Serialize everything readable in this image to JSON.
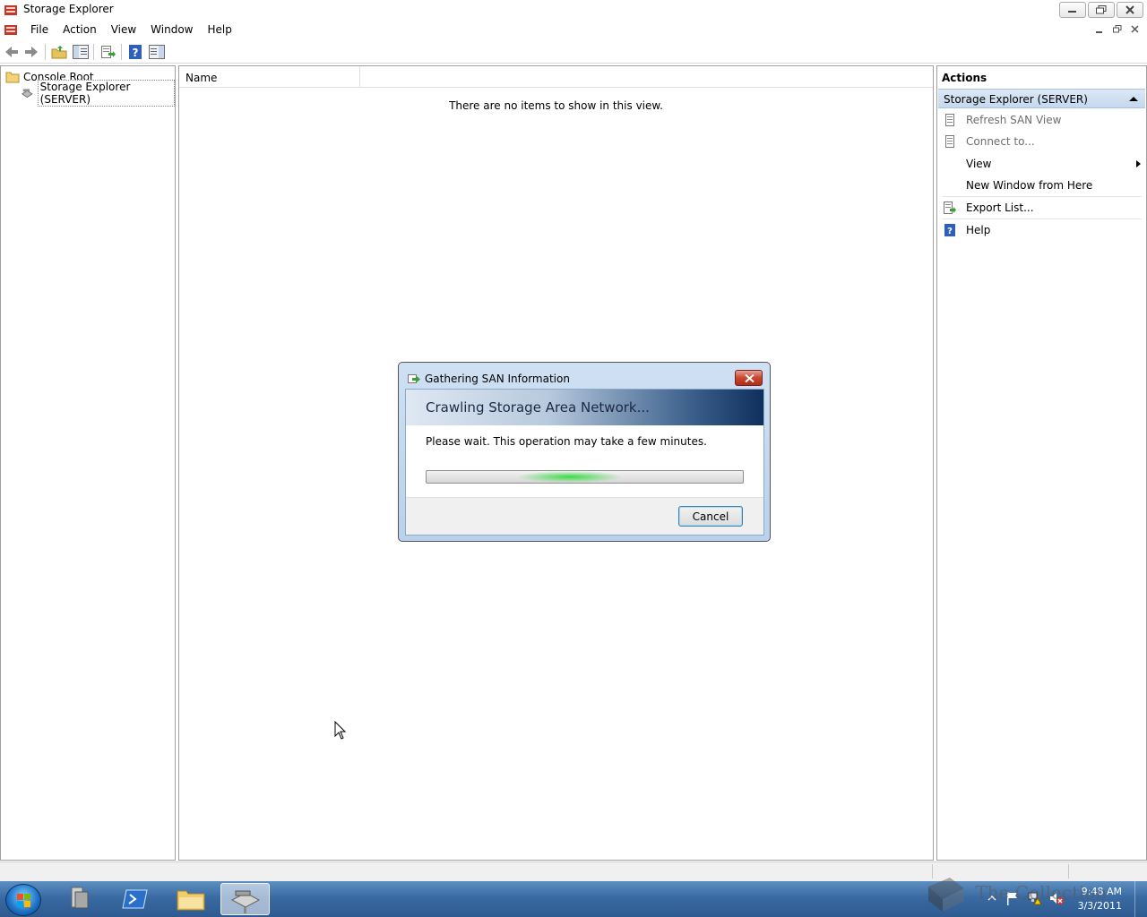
{
  "window": {
    "title": "Storage Explorer"
  },
  "menu": {
    "items": [
      "File",
      "Action",
      "View",
      "Window",
      "Help"
    ]
  },
  "tree": {
    "root": "Console Root",
    "child": "Storage Explorer (SERVER)"
  },
  "list": {
    "column_name": "Name",
    "empty_message": "There are no items to show in this view."
  },
  "actions": {
    "title": "Actions",
    "section": "Storage Explorer (SERVER)",
    "items": [
      {
        "label": "Refresh SAN View",
        "icon": "refresh-san-icon",
        "enabled": false
      },
      {
        "label": "Connect to...",
        "icon": "connect-icon",
        "enabled": false
      },
      {
        "label": "View",
        "icon": "",
        "enabled": true,
        "submenu": true
      },
      {
        "label": "New Window from Here",
        "icon": "",
        "enabled": true
      },
      {
        "label": "Export List...",
        "icon": "export-icon",
        "enabled": true
      },
      {
        "label": "Help",
        "icon": "help-icon",
        "enabled": true
      }
    ]
  },
  "dialog": {
    "title": "Gathering SAN Information",
    "heading": "Crawling Storage Area Network...",
    "message": "Please wait.  This operation may take a few minutes.",
    "cancel_label": "Cancel"
  },
  "taskbar": {
    "time": "9:48 AM",
    "date": "3/3/2011"
  },
  "watermark": "The Collection Book",
  "colors": {
    "selection_blue": "#c6d8ee",
    "taskbar_blue": "#3a6aa2",
    "progress_green": "#30dc3c"
  }
}
